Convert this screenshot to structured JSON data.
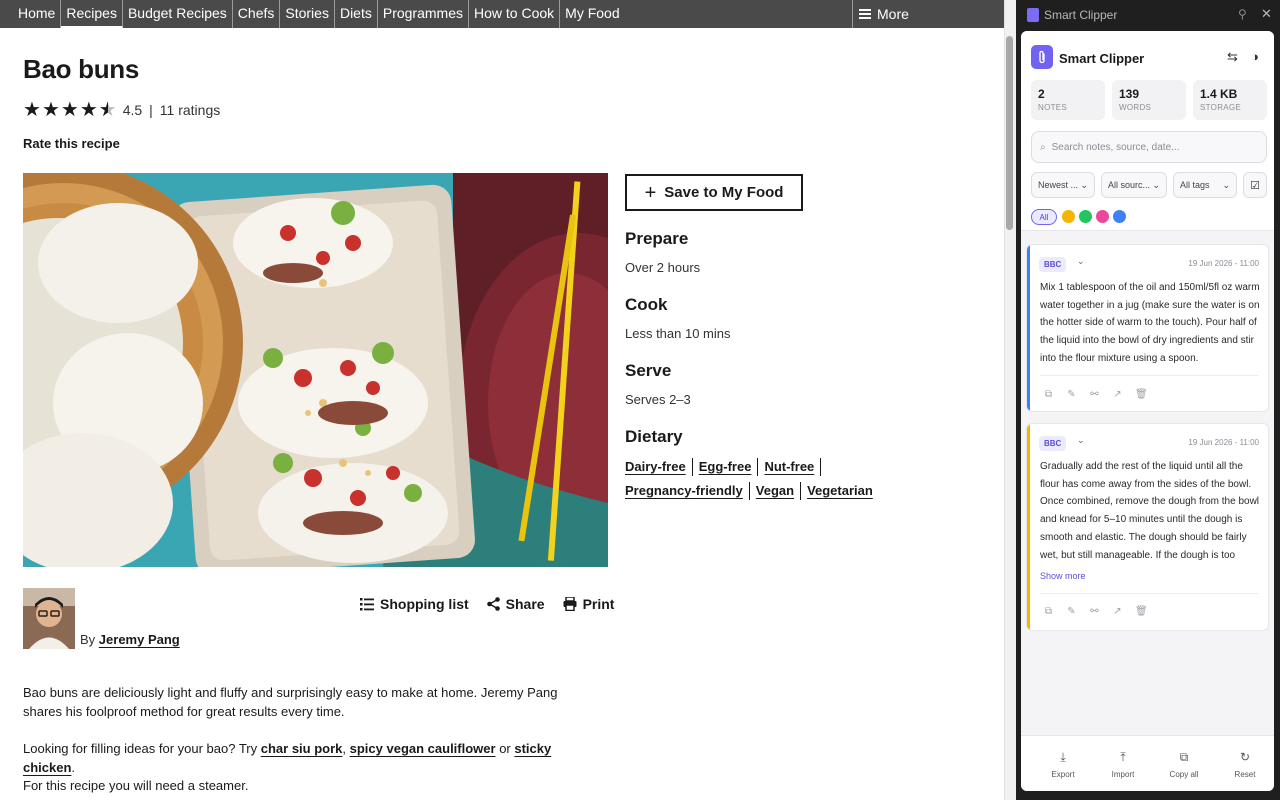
{
  "nav": {
    "items": [
      "Home",
      "Recipes",
      "Budget Recipes",
      "Chefs",
      "Stories",
      "Diets",
      "Programmes",
      "How to Cook",
      "My Food"
    ],
    "active": "Recipes",
    "more": "More"
  },
  "recipe": {
    "title": "Bao buns",
    "rating": {
      "value": "4.5",
      "stars": 4.5,
      "count": "11 ratings"
    },
    "rate_link": "Rate this recipe",
    "save_label": "Save to My Food",
    "prepare": {
      "heading": "Prepare",
      "value": "Over 2 hours"
    },
    "cook": {
      "heading": "Cook",
      "value": "Less than 10 mins"
    },
    "serve": {
      "heading": "Serve",
      "value": "Serves 2–3"
    },
    "dietary": {
      "heading": "Dietary",
      "row1": [
        "Dairy-free",
        "Egg-free",
        "Nut-free"
      ],
      "row2": [
        "Pregnancy-friendly",
        "Vegan",
        "Vegetarian"
      ]
    },
    "author": {
      "by": "By",
      "name": "Jeremy Pang"
    },
    "actions": {
      "shopping": "Shopping list",
      "share": "Share",
      "print": "Print"
    },
    "desc1": "Bao buns are deliciously light and fluffy and surprisingly easy to make at home. Jeremy Pang shares his foolproof method for great results every time.",
    "desc2": {
      "prefix": "Looking for filling ideas for your bao? Try ",
      "link1": "char siu pork",
      "sep1": ", ",
      "link2": "spicy vegan cauliflower",
      "sep2": " or ",
      "link3": "sticky chicken",
      "suffix": "."
    },
    "desc3": "For this recipe you will need a steamer."
  },
  "clipper": {
    "window_title": "Smart Clipper",
    "app_name": "Smart Clipper",
    "stats": [
      {
        "value": "2",
        "label": "NOTES"
      },
      {
        "value": "139",
        "label": "WORDS"
      },
      {
        "value": "1.4 KB",
        "label": "STORAGE"
      }
    ],
    "search_placeholder": "Search notes, source, date...",
    "filters": {
      "sort": "Newest ...",
      "source": "All sourc...",
      "tags": "All tags"
    },
    "chip_all": "All",
    "colors": [
      "#f4b400",
      "#22c55e",
      "#ec4899",
      "#3b82f6"
    ],
    "notes": [
      {
        "source": "BBC",
        "date": "19 Jun 2026 - 11:00",
        "color": "#3b82f6",
        "text": "Mix 1 tablespoon of the oil and 150ml/5fl oz warm water together in a jug (make sure the water is on the hotter side of warm to the touch). Pour half of the liquid into the bowl of dry ingredients and stir into the flour mixture using a spoon."
      },
      {
        "source": "BBC",
        "date": "19 Jun 2026 - 11:00",
        "color": "#f4b400",
        "text": "Gradually add the rest of the liquid until all the flour has come away from the sides of the bowl. Once combined, remove the dough from the bowl and knead for 5–10 minutes until the dough is smooth and elastic. The dough should be fairly wet, but still manageable. If the dough is too sticky, use a little ...",
        "show_more": "Show more"
      }
    ],
    "footer": [
      "Export",
      "Import",
      "Copy all",
      "Reset"
    ]
  }
}
